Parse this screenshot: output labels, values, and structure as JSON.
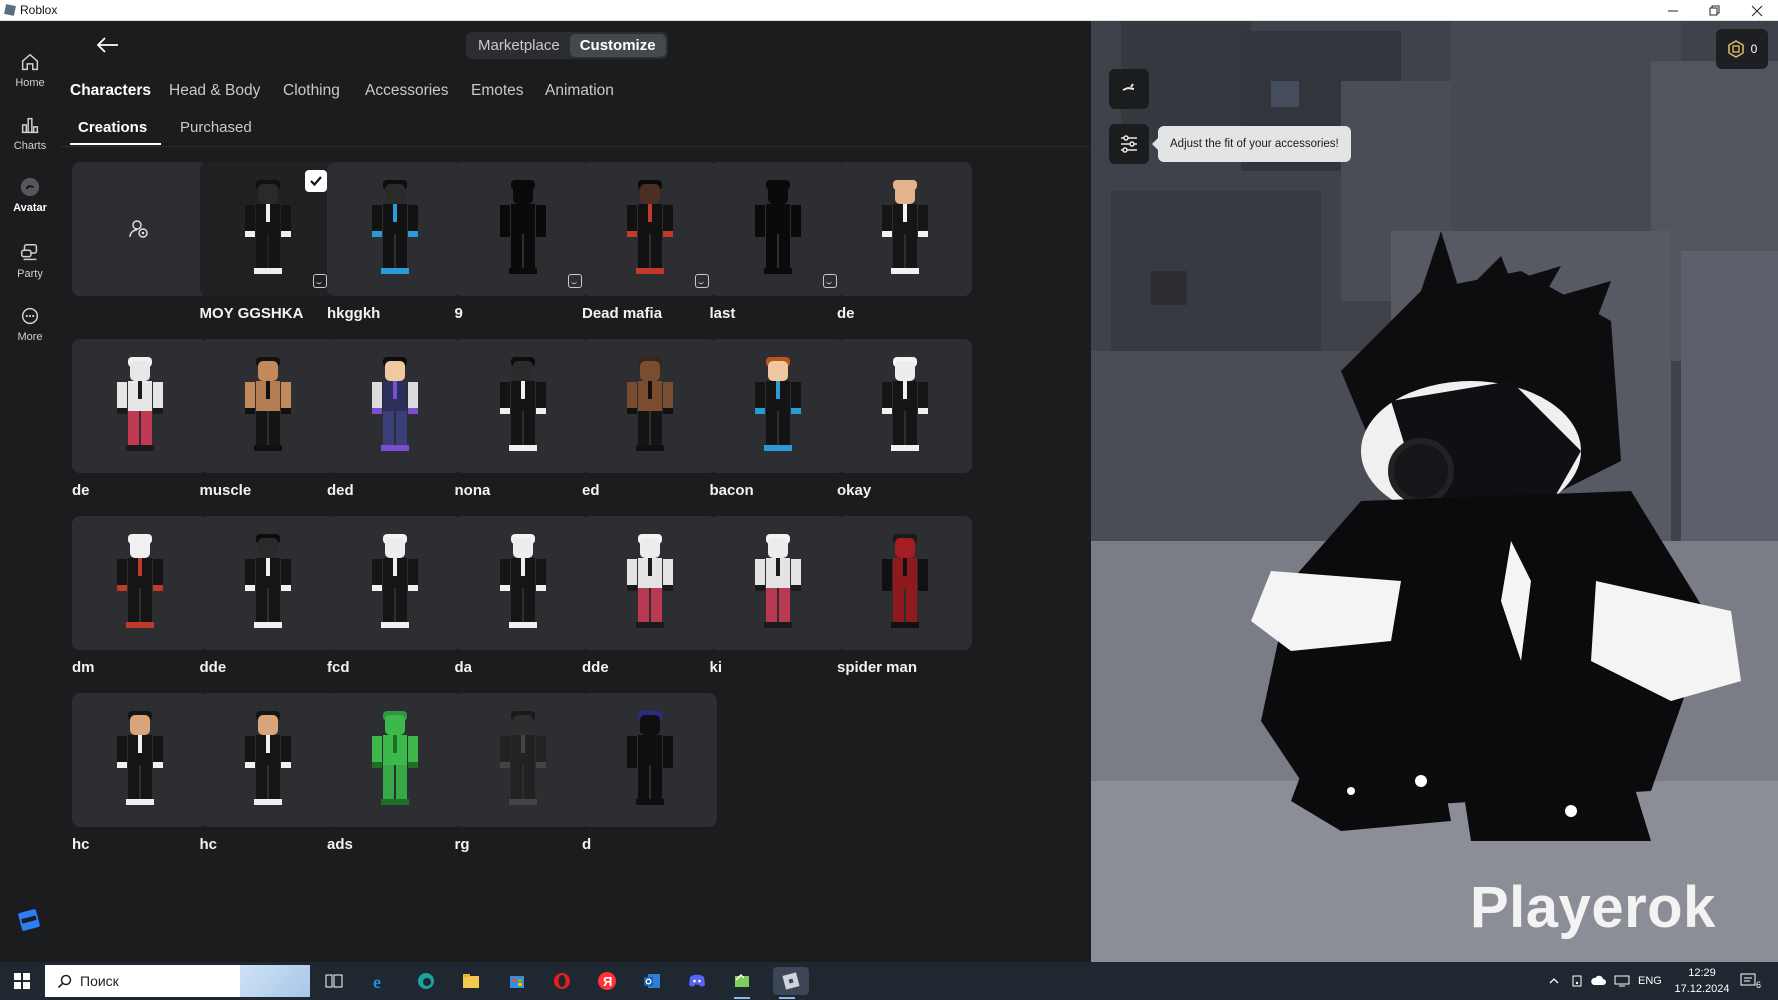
{
  "window": {
    "title": "Roblox"
  },
  "sidenav": {
    "items": [
      {
        "label": "Home",
        "icon": "home-icon"
      },
      {
        "label": "Charts",
        "icon": "charts-icon"
      },
      {
        "label": "Avatar",
        "icon": "avatar-icon"
      },
      {
        "label": "Party",
        "icon": "party-icon"
      },
      {
        "label": "More",
        "icon": "more-icon"
      }
    ],
    "active": "Avatar"
  },
  "topbar": {
    "marketplace_label": "Marketplace",
    "customize_label": "Customize",
    "active": "Customize"
  },
  "categories": {
    "items": [
      "Characters",
      "Head & Body",
      "Clothing",
      "Accessories",
      "Emotes",
      "Animation"
    ],
    "active": "Characters"
  },
  "subtabs": {
    "items": [
      "Creations",
      "Purchased"
    ],
    "active": "Creations"
  },
  "characters": [
    {
      "name": "",
      "kind": "create",
      "icon": "create-outfit-icon"
    },
    {
      "name": "MOY GGSHKA",
      "selected": true,
      "badge": true,
      "skin": "#2a2a2a",
      "hair": "#111111",
      "torso": "#141414",
      "legs": "#141414",
      "arms": "#141414",
      "accent": "#efefef"
    },
    {
      "name": "hkggkh",
      "skin": "#2a2a2a",
      "hair": "#0d0d0d",
      "torso": "#121212",
      "legs": "#121212",
      "arms": "#121212",
      "accent": "#2a9bd6"
    },
    {
      "name": "9",
      "badge": true,
      "skin": "#0a0a0a",
      "hair": "#0a0a0a",
      "torso": "#0a0a0a",
      "legs": "#0a0a0a",
      "arms": "#0a0a0a",
      "accent": "#0a0a0a"
    },
    {
      "name": "Dead mafia",
      "badge": true,
      "skin": "#4a2f22",
      "hair": "#0b0b0b",
      "torso": "#121212",
      "legs": "#121212",
      "arms": "#121212",
      "accent": "#c0392b"
    },
    {
      "name": "last",
      "badge": true,
      "skin": "#0a0a0a",
      "hair": "#0a0a0a",
      "torso": "#0a0a0a",
      "legs": "#0a0a0a",
      "arms": "#0a0a0a",
      "accent": "#0a0a0a"
    },
    {
      "name": "de",
      "skin": "#e2b48c",
      "hair": "#e2b48c",
      "torso": "#151515",
      "legs": "#151515",
      "arms": "#151515",
      "accent": "#f2f2f2"
    },
    {
      "name": "de",
      "skin": "#e8e8e8",
      "hair": "#f0f0f0",
      "torso": "#e6e6e6",
      "legs": "#c03a53",
      "arms": "#e6e6e6",
      "accent": "#1a1a1a"
    },
    {
      "name": "muscle",
      "skin": "#c28a5a",
      "hair": "#101010",
      "torso": "#b27d52",
      "legs": "#141414",
      "arms": "#c28a5a",
      "accent": "#111"
    },
    {
      "name": "ded",
      "skin": "#f1c9a0",
      "hair": "#0c0c0c",
      "torso": "#2b2f5a",
      "legs": "#3a3f7a",
      "arms": "#dcdcdc",
      "accent": "#7b4dd1"
    },
    {
      "name": "nona",
      "skin": "#2b2b2b",
      "hair": "#0d0d0d",
      "torso": "#141414",
      "legs": "#141414",
      "arms": "#141414",
      "accent": "#f0f0f0"
    },
    {
      "name": "ed",
      "skin": "#7a4c30",
      "hair": "#3a2418",
      "torso": "#7a4c30",
      "legs": "#141414",
      "arms": "#7a4c30",
      "accent": "#111"
    },
    {
      "name": "bacon",
      "skin": "#f0c8a0",
      "hair": "#b8561d",
      "torso": "#141414",
      "legs": "#141414",
      "arms": "#141414",
      "accent": "#2a9bd6"
    },
    {
      "name": "okay",
      "skin": "#ededed",
      "hair": "#f5f5f5",
      "torso": "#151515",
      "legs": "#151515",
      "arms": "#151515",
      "accent": "#f0f0f0"
    },
    {
      "name": "dm",
      "skin": "#f0f0f0",
      "hair": "#f2f2f2",
      "torso": "#151515",
      "legs": "#151515",
      "arms": "#151515",
      "accent": "#c0392b"
    },
    {
      "name": "dde",
      "skin": "#2a2a2a",
      "hair": "#0d0d0d",
      "torso": "#151515",
      "legs": "#151515",
      "arms": "#151515",
      "accent": "#f0f0f0"
    },
    {
      "name": "fcd",
      "skin": "#ededed",
      "hair": "#f4f4f4",
      "torso": "#151515",
      "legs": "#151515",
      "arms": "#151515",
      "accent": "#f0f0f0"
    },
    {
      "name": "da",
      "skin": "#ededed",
      "hair": "#f4f4f4",
      "torso": "#151515",
      "legs": "#151515",
      "arms": "#151515",
      "accent": "#f0f0f0"
    },
    {
      "name": "dde",
      "skin": "#ececec",
      "hair": "#f3f3f3",
      "torso": "#e4e4e4",
      "legs": "#b73a52",
      "arms": "#e4e4e4",
      "accent": "#1a1a1a"
    },
    {
      "name": "ki",
      "skin": "#ececec",
      "hair": "#f3f3f3",
      "torso": "#e4e4e4",
      "legs": "#b73a52",
      "arms": "#e4e4e4",
      "accent": "#1a1a1a"
    },
    {
      "name": "spider man",
      "skin": "#a31e22",
      "hair": "#1a1a1a",
      "torso": "#8e1a1e",
      "legs": "#8e1a1e",
      "arms": "#111111",
      "accent": "#111111"
    },
    {
      "name": "hc",
      "skin": "#d8a47c",
      "hair": "#141414",
      "torso": "#151515",
      "legs": "#151515",
      "arms": "#151515",
      "accent": "#f0f0f0"
    },
    {
      "name": "hc",
      "skin": "#d8a47c",
      "hair": "#141414",
      "torso": "#151515",
      "legs": "#151515",
      "arms": "#151515",
      "accent": "#f0f0f0"
    },
    {
      "name": "ads",
      "skin": "#3db84a",
      "hair": "#2e9a3b",
      "torso": "#3db84a",
      "legs": "#36a845",
      "arms": "#3db84a",
      "accent": "#1f6e28"
    },
    {
      "name": "rg",
      "skin": "#2e2e2e",
      "hair": "#1a1a1a",
      "torso": "#222",
      "legs": "#222",
      "arms": "#222",
      "accent": "#444"
    },
    {
      "name": "d",
      "skin": "#0f0f0f",
      "hair": "#2a2a8a",
      "torso": "#0f0f0f",
      "legs": "#0f0f0f",
      "arms": "#0f0f0f",
      "accent": "#0f0f0f"
    }
  ],
  "preview": {
    "tooltip": "Adjust the fit of your accessories!",
    "robux_count": "0",
    "watermark": "Playerok"
  },
  "taskbar": {
    "search_placeholder": "Поиск",
    "apps": [
      "task-view-icon",
      "internet-explorer-icon",
      "edge-icon",
      "file-explorer-icon",
      "store-icon",
      "opera-icon",
      "yandex-icon",
      "outlook-icon",
      "discord-icon",
      "app-icon",
      "roblox-icon"
    ],
    "lang": "ENG",
    "time": "12:29",
    "date": "17.12.2024",
    "notif_count": "6"
  },
  "colors": {
    "bg": "#1b1c1e",
    "tile": "#2d2e31",
    "tooltip": "#e3e4e6",
    "taskbar": "#1f2731"
  }
}
